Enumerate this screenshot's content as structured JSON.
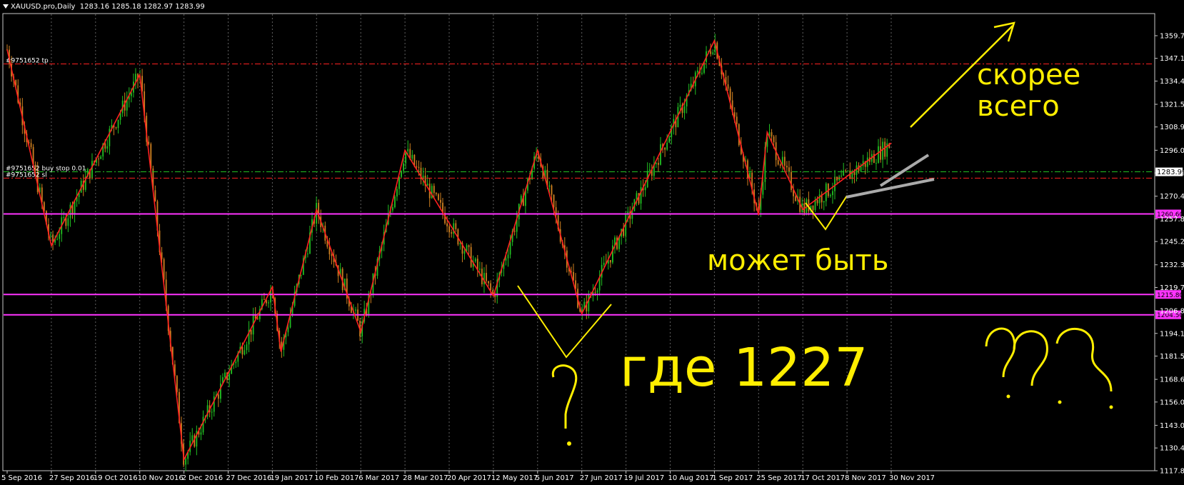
{
  "header": {
    "symbol": "XAUUSD.pro,Daily",
    "ohlc": "1283.16 1285.18 1282.97 1283.99"
  },
  "chart_data": {
    "type": "candlestick",
    "symbol": "XAUUSD.pro",
    "timeframe": "Daily",
    "ylim": [
      1117.8,
      1372.0
    ],
    "y_ticks": [
      "1359.70",
      "1347.10",
      "1334.45",
      "1321.55",
      "1308.95",
      "1296.00",
      "1283.40",
      "1270.45",
      "1257.85",
      "1245.25",
      "1232.30",
      "1219.70",
      "1206.80",
      "1194.15",
      "1181.55",
      "1168.60",
      "1156.00",
      "1143.05",
      "1130.45",
      "1117.80"
    ],
    "x_ticks": [
      "5 Sep 2016",
      "27 Sep 2016",
      "19 Oct 2016",
      "10 Nov 2016",
      "2 Dec 2016",
      "27 Dec 2016",
      "19 Jan 2017",
      "10 Feb 2017",
      "6 Mar 2017",
      "28 Mar 2017",
      "20 Apr 2017",
      "12 May 2017",
      "5 Jun 2017",
      "27 Jun 2017",
      "19 Jul 2017",
      "10 Aug 2017",
      "1 Sep 2017",
      "25 Sep 2017",
      "17 Oct 2017",
      "8 Nov 2017",
      "30 Nov 2017"
    ],
    "grid": true,
    "current_price": "1283.99",
    "zigzag": [
      {
        "x": "5 Sep 2016",
        "y": 1352
      },
      {
        "x": "27 Sep 2016",
        "y": 1243
      },
      {
        "x": "10 Nov 2016",
        "y": 1338
      },
      {
        "x": "2 Dec 2016",
        "y": 1124
      },
      {
        "x": "19 Jan 2017",
        "y": 1220
      },
      {
        "x": "19 Jan 2017",
        "y": 1184
      },
      {
        "x": "10 Feb 2017",
        "y": 1263
      },
      {
        "x": "6 Mar 2017",
        "y": 1195
      },
      {
        "x": "28 Mar 2017",
        "y": 1296
      },
      {
        "x": "12 May 2017",
        "y": 1215
      },
      {
        "x": "5 Jun 2017",
        "y": 1296
      },
      {
        "x": "27 Jun 2017",
        "y": 1205
      },
      {
        "x": "1 Sep 2017",
        "y": 1357
      },
      {
        "x": "25 Sep 2017",
        "y": 1260
      },
      {
        "x": "25 Sep 2017",
        "y": 1306
      },
      {
        "x": "17 Oct 2017",
        "y": 1263
      },
      {
        "x": "30 Nov 2017",
        "y": 1300
      }
    ],
    "hlines": [
      {
        "label": "#9751652 tp",
        "price": 1344.0,
        "color": "#ff2020",
        "style": "dashdot",
        "tag": ""
      },
      {
        "label": "#9751652 buy stop 0.01",
        "price": 1284.0,
        "color": "#22c022",
        "style": "dashdot",
        "tag": ""
      },
      {
        "label": "#9751652 sl",
        "price": 1280.5,
        "color": "#ff2020",
        "style": "dashdot",
        "tag": ""
      },
      {
        "label": "",
        "price": 1260.6,
        "color": "#ff33ff",
        "style": "solid",
        "tag": "1260.60"
      },
      {
        "label": "",
        "price": 1215.8,
        "color": "#ff33ff",
        "style": "solid",
        "tag": "1215.80"
      },
      {
        "label": "",
        "price": 1204.5,
        "color": "#ff33ff",
        "style": "solid",
        "tag": "1204.50"
      }
    ],
    "annotations": [
      {
        "text": "скорее",
        "color": "#ffee00"
      },
      {
        "text": "всего",
        "color": "#ffee00"
      },
      {
        "text": "может быть",
        "color": "#ffee00"
      },
      {
        "text": "где 1227",
        "color": "#ffee00"
      },
      {
        "text": "?",
        "color": "#ffee00"
      },
      {
        "text": "???",
        "color": "#ffee00"
      }
    ],
    "colors": {
      "background": "#000000",
      "bull": "#22c022",
      "bear": "#d08020",
      "zigzag": "#ff2020",
      "axis_text": "#ffffff",
      "grid": "#606060",
      "annotation": "#ffee00",
      "trendline": "#aaaaaa",
      "price_tag_bg": "#ff33ff",
      "current_tag_bg": "#ffffff"
    }
  }
}
